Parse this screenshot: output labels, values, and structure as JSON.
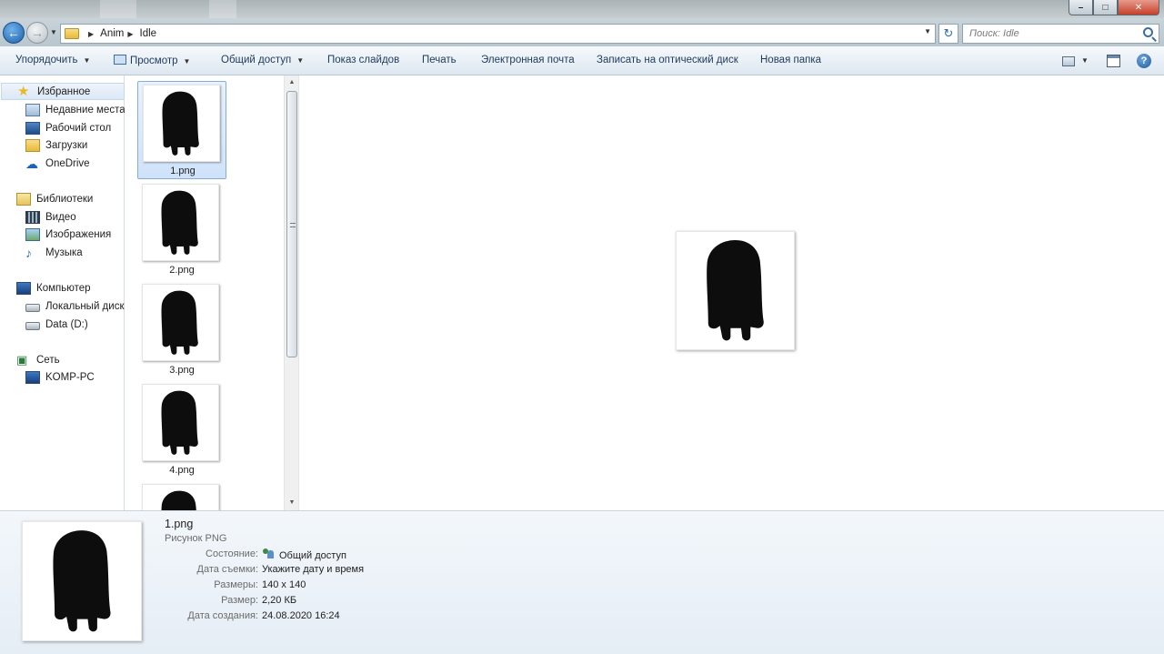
{
  "address": {
    "breadcrumbs": [
      "Anim",
      "Idle"
    ],
    "search_placeholder": "Поиск: Idle"
  },
  "toolbar": {
    "organize": "Упорядочить",
    "preview": "Просмотр",
    "share": "Общий доступ",
    "slideshow": "Показ слайдов",
    "print": "Печать",
    "email": "Электронная почта",
    "burn": "Записать на оптический диск",
    "new_folder": "Новая папка"
  },
  "sidebar": {
    "favorites": {
      "label": "Избранное",
      "items": [
        "Недавние места",
        "Рабочий стол",
        "Загрузки",
        "OneDrive"
      ]
    },
    "libraries": {
      "label": "Библиотеки",
      "items": [
        "Видео",
        "Изображения",
        "Музыка"
      ]
    },
    "computer": {
      "label": "Компьютер",
      "items": [
        "Локальный диск",
        "Data (D:)"
      ]
    },
    "network": {
      "label": "Сеть",
      "items": [
        "KOMP-PC"
      ]
    }
  },
  "files": [
    {
      "name": "1.png",
      "selected": true
    },
    {
      "name": "2.png",
      "selected": false
    },
    {
      "name": "3.png",
      "selected": false
    },
    {
      "name": "4.png",
      "selected": false
    },
    {
      "name": "",
      "selected": false
    }
  ],
  "details": {
    "name": "1.png",
    "type": "Рисунок PNG",
    "rows": [
      {
        "label": "Состояние:",
        "value": "Общий доступ"
      },
      {
        "label": "Дата съемки:",
        "value": "Укажите дату и время"
      },
      {
        "label": "Размеры:",
        "value": "140 x 140"
      },
      {
        "label": "Размер:",
        "value": "2,20 КБ"
      },
      {
        "label": "Дата создания:",
        "value": "24.08.2020 16:24"
      }
    ]
  },
  "icons": {
    "back": "back-arrow-icon",
    "forward": "forward-arrow-icon",
    "refresh": "refresh-icon",
    "search": "search-icon",
    "help": "help-icon"
  }
}
